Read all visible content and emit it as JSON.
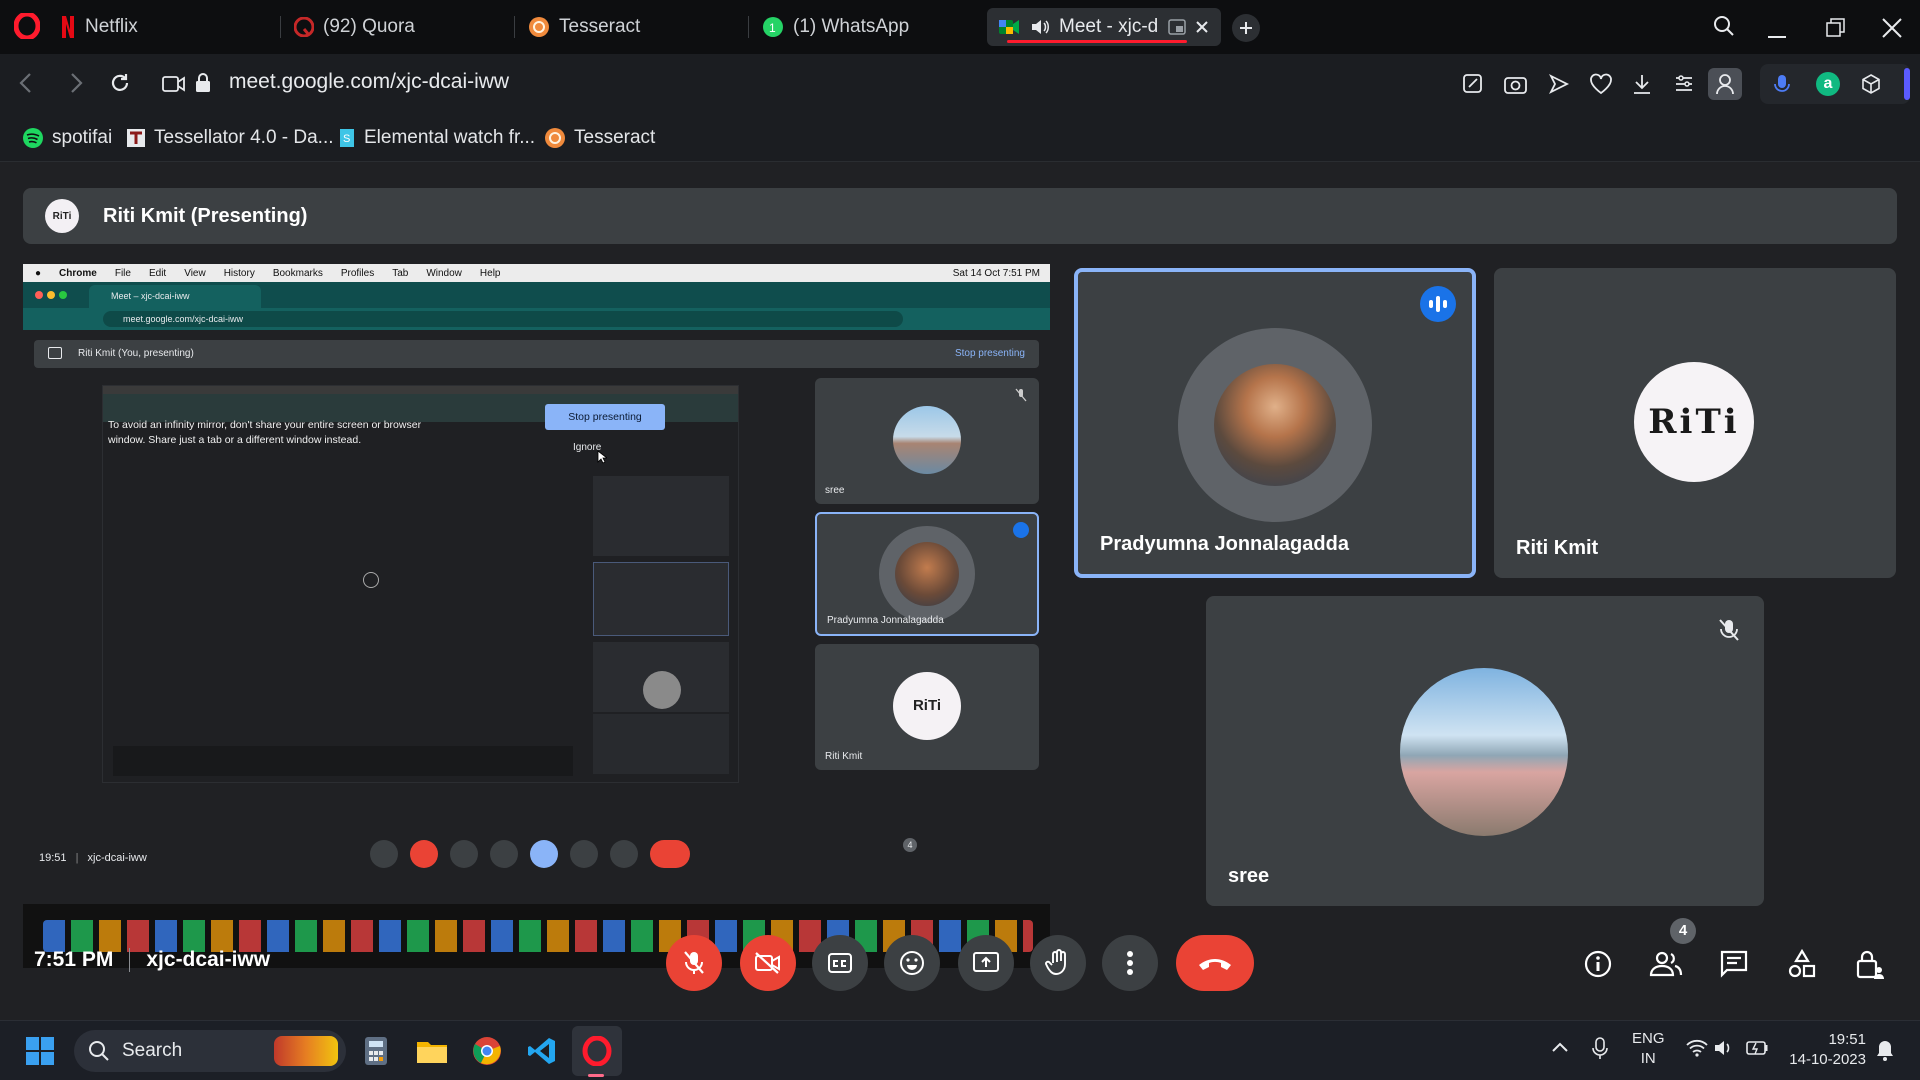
{
  "tabs": [
    {
      "label": "Netflix",
      "icon": "netflix-icon"
    },
    {
      "label": "(92) Quora",
      "icon": "quora-icon"
    },
    {
      "label": "Tesseract",
      "icon": "tesseract-icon"
    },
    {
      "label": "(1) WhatsApp",
      "icon": "whatsapp-icon"
    },
    {
      "label": "Meet - xjc-dc",
      "icon": "meet-icon",
      "active": true
    }
  ],
  "address": {
    "url": "meet.google.com/xjc-dcai-iww"
  },
  "bookmarks": [
    {
      "label": "spotifai",
      "icon": "spotify-icon"
    },
    {
      "label": "Tessellator 4.0 - Da...",
      "icon": "tessellator-icon"
    },
    {
      "label": "Elemental watch fr...",
      "icon": "elemental-icon"
    },
    {
      "label": "Tesseract",
      "icon": "tesseract-icon"
    }
  ],
  "presenter": {
    "title": "Riti Kmit (Presenting)",
    "avatar_text": "RiTi"
  },
  "shared_screen": {
    "menubar": [
      "Chrome",
      "File",
      "Edit",
      "View",
      "History",
      "Bookmarks",
      "Profiles",
      "Tab",
      "Window",
      "Help"
    ],
    "clock": "Sat 14 Oct  7:51 PM",
    "tab_title": "Meet – xjc-dcai-iww",
    "url": "meet.google.com/xjc-dcai-iww",
    "presenting_label": "Riti Kmit (You, presenting)",
    "stop_presenting_link": "Stop presenting",
    "warning_line1": "To avoid an infinity mirror, don't share your entire screen or browser",
    "warning_line2": "window. Share just a tab or a different window instead.",
    "stop_button": "Stop presenting",
    "ignore": "Ignore",
    "tiles": [
      "sree",
      "Pradyumna Jonnalagadda",
      "Riti Kmit"
    ],
    "footer_time": "19:51",
    "footer_code": "xjc-dcai-iww",
    "participant_count": "4"
  },
  "participants": [
    {
      "name": "Pradyumna Jonnalagadda",
      "speaking": true
    },
    {
      "name": "Riti Kmit",
      "speaking": false
    },
    {
      "name": "sree",
      "muted": true
    }
  ],
  "footer": {
    "time": "7:51 PM",
    "code": "xjc-dcai-iww",
    "people_count": "4"
  },
  "taskbar": {
    "search": "Search",
    "lang1": "ENG",
    "lang2": "IN",
    "time": "19:51",
    "date": "14-10-2023"
  },
  "colors": {
    "accent": "#8ab4f8",
    "danger": "#ea4335",
    "tile": "#3c4043",
    "speaking_border": "#8ab4f8"
  }
}
